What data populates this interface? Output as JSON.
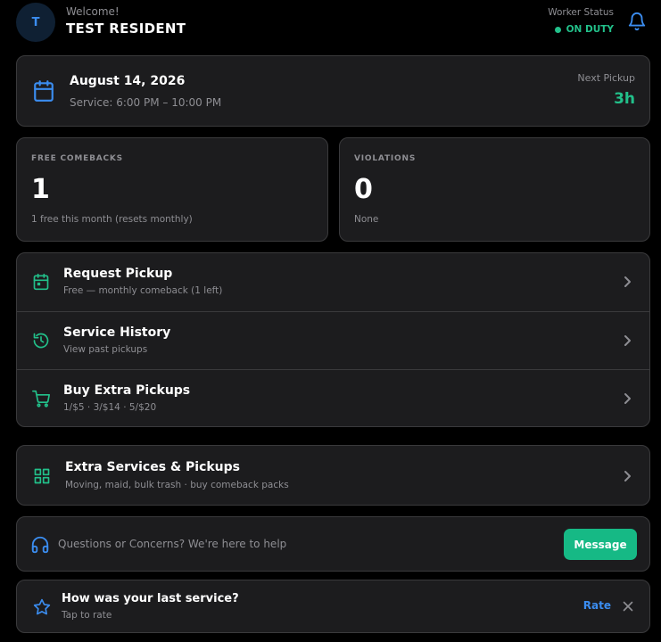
{
  "header": {
    "avatar_initial": "T",
    "welcome": "Welcome!",
    "name": "TEST RESIDENT",
    "worker_status_label": "Worker Status",
    "worker_status": "ON DUTY"
  },
  "service": {
    "date": "August 14, 2026",
    "window": "Service: 6:00 PM – 10:00 PM",
    "next_pickup_label": "Next Pickup",
    "next_pickup_value": "3h"
  },
  "stats": {
    "free_comebacks": {
      "label": "FREE COMEBACKS",
      "value": "1",
      "sub": "1 free this month (resets monthly)"
    },
    "violations": {
      "label": "VIOLATIONS",
      "value": "0",
      "sub": "None"
    }
  },
  "menu": [
    {
      "title": "Request Pickup",
      "sub": "Free — monthly comeback (1 left)",
      "icon": "calendar-plus-icon"
    },
    {
      "title": "Service History",
      "sub": "View past pickups",
      "icon": "history-icon"
    },
    {
      "title": "Buy Extra Pickups",
      "sub": "1/$5 · 3/$14 · 5/$20",
      "icon": "cart-icon"
    }
  ],
  "extra_services": {
    "title": "Extra Services & Pickups",
    "sub": "Moving, maid, bulk trash · buy comeback packs",
    "icon": "grid-icon"
  },
  "help": {
    "text": "Questions or Concerns? We're here to help",
    "button": "Message",
    "icon": "headset-icon"
  },
  "rating": {
    "title": "How was your last service?",
    "sub": "Tap to rate",
    "action": "Rate",
    "icon": "star-icon"
  },
  "colors": {
    "background": "#000000",
    "card": "#1c1c1e",
    "border": "#3a3a3c",
    "accent_green": "#22c08a",
    "accent_blue": "#3b8df0",
    "muted_text": "#8e8e93"
  }
}
